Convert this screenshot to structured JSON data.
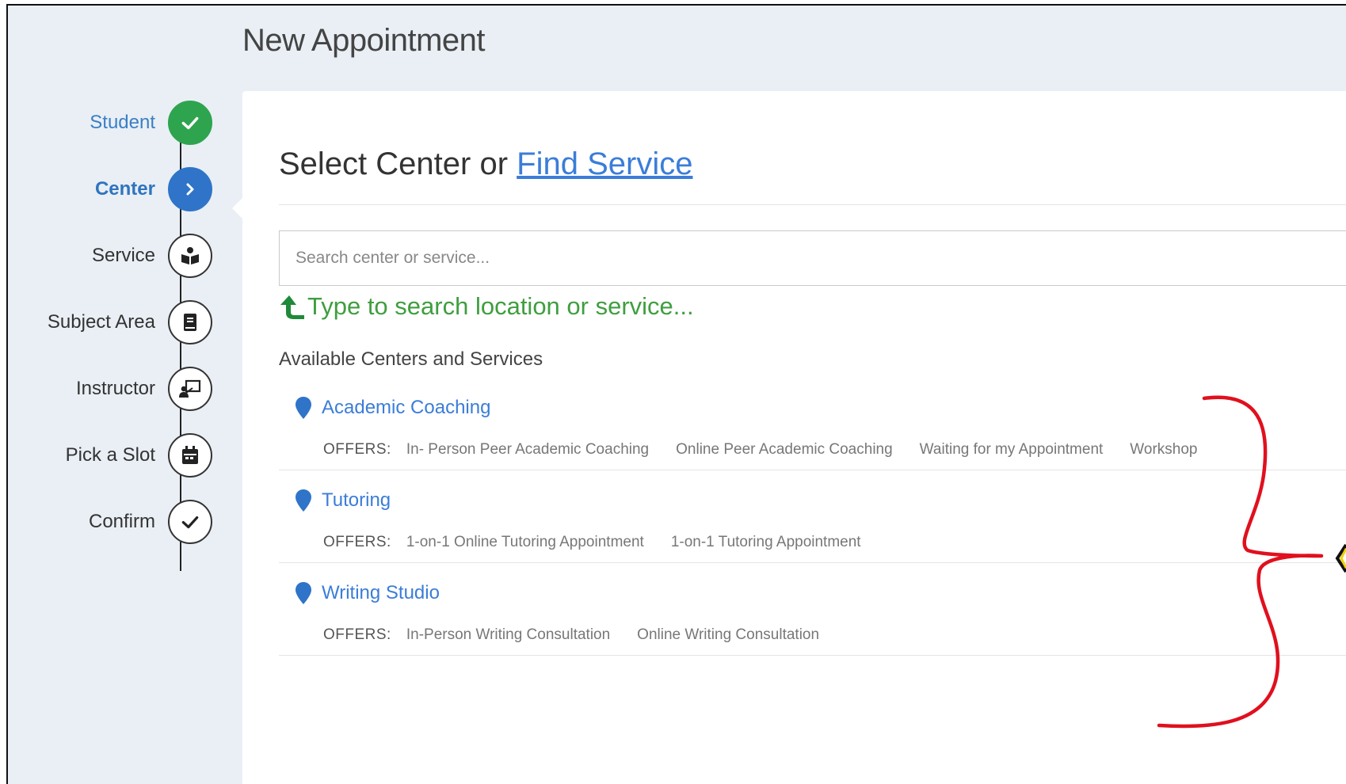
{
  "page_title": "New Appointment",
  "steps": [
    {
      "label": "Student",
      "state": "done",
      "icon": "check-icon"
    },
    {
      "label": "Center",
      "state": "active",
      "icon": "chevron-right-icon"
    },
    {
      "label": "Service",
      "state": "pending",
      "icon": "reading-person-icon"
    },
    {
      "label": "Subject Area",
      "state": "pending",
      "icon": "book-icon"
    },
    {
      "label": "Instructor",
      "state": "pending",
      "icon": "presenter-icon"
    },
    {
      "label": "Pick a Slot",
      "state": "pending",
      "icon": "calendar-icon"
    },
    {
      "label": "Confirm",
      "state": "pending",
      "icon": "check-icon"
    }
  ],
  "heading": {
    "text": "Select Center or",
    "link": "Find Service"
  },
  "search": {
    "placeholder": "Search center or service..."
  },
  "hint": "Type to search location or service...",
  "available_label": "Available Centers and Services",
  "offers_label": "OFFERS:",
  "centers": [
    {
      "name": "Academic Coaching",
      "offers": [
        "In- Person Peer Academic Coaching",
        "Online Peer Academic Coaching",
        "Waiting for my Appointment",
        "Workshop"
      ]
    },
    {
      "name": "Tutoring",
      "offers": [
        "1-on-1 Online Tutoring Appointment",
        "1-on-1 Tutoring Appointment"
      ]
    },
    {
      "name": "Writing Studio",
      "offers": [
        "In-Person Writing Consultation",
        "Online Writing Consultation"
      ]
    }
  ],
  "colors": {
    "done": "#2ea44f",
    "active": "#2f74c8",
    "link": "#3b7dd8",
    "hint": "#3f9e3f",
    "annotation": "#e0101e"
  }
}
